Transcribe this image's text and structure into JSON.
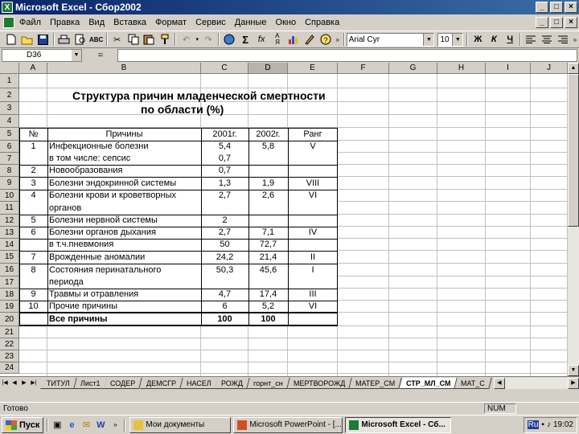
{
  "window": {
    "title": "Microsoft Excel - Сбор2002",
    "buttons": [
      "_",
      "□",
      "×"
    ]
  },
  "menu": [
    "Файл",
    "Правка",
    "Вид",
    "Вставка",
    "Формат",
    "Сервис",
    "Данные",
    "Окно",
    "Справка"
  ],
  "toolbar": {
    "font_name": "Arial Cyr",
    "font_size": "10",
    "bold": "Ж",
    "italic": "К",
    "underline": "Ч",
    "sum": "Σ",
    "fx": "fx"
  },
  "formula_bar": {
    "cell_ref": "D36",
    "equals": "=",
    "value": ""
  },
  "columns": [
    "A",
    "B",
    "C",
    "D",
    "E",
    "F",
    "G",
    "H",
    "I",
    "J"
  ],
  "selected_column": "D",
  "rows": [
    "1",
    "2",
    "3",
    "4",
    "5",
    "6",
    "7",
    "8",
    "9",
    "10",
    "11",
    "12",
    "13",
    "14",
    "15",
    "16",
    "17",
    "18",
    "19",
    "20",
    "21",
    "22",
    "23",
    "24"
  ],
  "sheet": {
    "title_line1": "Структура причин младенческой смертности",
    "title_line2": "по области (%)",
    "headers": {
      "num": "№",
      "cause": "Причины",
      "y2001": "2001г.",
      "y2002": "2002г.",
      "rank": "Ранг"
    },
    "lines": [
      {
        "row": "6",
        "num": "1",
        "cause": "Инфекционные болезни",
        "y2001": "5,4",
        "y2002": "5,8",
        "rank": "V"
      },
      {
        "row": "7",
        "num": "",
        "cause": "в том числе: сепсис",
        "y2001": "0,7",
        "y2002": "",
        "rank": ""
      },
      {
        "row": "8",
        "num": "2",
        "cause": "Новообразования",
        "y2001": "0,7",
        "y2002": "",
        "rank": ""
      },
      {
        "row": "9",
        "num": "3",
        "cause": "Болезни эндокринной системы",
        "y2001": "1,3",
        "y2002": "1,9",
        "rank": "VIII"
      },
      {
        "row": "10",
        "num": "4",
        "cause": "Болезни крови и кроветворных",
        "y2001": "2,7",
        "y2002": "2,6",
        "rank": "VI"
      },
      {
        "row": "11",
        "num": "",
        "cause": "органов",
        "y2001": "",
        "y2002": "",
        "rank": ""
      },
      {
        "row": "12",
        "num": "5",
        "cause": "Болезни нервной системы",
        "y2001": "2",
        "y2002": "",
        "rank": ""
      },
      {
        "row": "13",
        "num": "6",
        "cause": "Болезни органов дыхания",
        "y2001": "2,7",
        "y2002": "7,1",
        "rank": "IV"
      },
      {
        "row": "14",
        "num": "",
        "cause": "в т.ч.пневмония",
        "y2001": "50",
        "y2002": "72,7",
        "rank": ""
      },
      {
        "row": "15",
        "num": "7",
        "cause": "Врожденные аномалии",
        "y2001": "24,2",
        "y2002": "21,4",
        "rank": "II"
      },
      {
        "row": "16",
        "num": "8",
        "cause": "Состояния перинатального",
        "y2001": "50,3",
        "y2002": "45,6",
        "rank": "I"
      },
      {
        "row": "17",
        "num": "",
        "cause": "периода",
        "y2001": "",
        "y2002": "",
        "rank": ""
      },
      {
        "row": "18",
        "num": "9",
        "cause": "Травмы и отравления",
        "y2001": "4,7",
        "y2002": "17,4",
        "rank": "III"
      },
      {
        "row": "19",
        "num": "10",
        "cause": "Прочие причины",
        "y2001": "6",
        "y2002": "5,2",
        "rank": "VI"
      },
      {
        "row": "20",
        "num": "",
        "cause": "Все причины",
        "y2001": "100",
        "y2002": "100",
        "rank": ""
      }
    ]
  },
  "tabs": [
    "ТИТУЛ",
    "Лист1",
    "СОДЕР",
    "ДЕМСГР",
    "НАСЕЛ",
    "РОЖД",
    "горнт_сн",
    "МЕРТВОРОЖД",
    "МАТЕР_СМ",
    "СТР_МЛ_СМ",
    "МАТ_С"
  ],
  "active_tab": "СТР_МЛ_СМ",
  "status": {
    "ready": "Готово",
    "num": "NUM"
  },
  "taskbar": {
    "start": "Пуск",
    "tasks": [
      "Мои документы",
      "Microsoft PowerPoint - [...",
      "Microsoft Excel - Сб..."
    ],
    "active_task": 2,
    "tray_lang": "Ru",
    "clock": "19:02"
  }
}
